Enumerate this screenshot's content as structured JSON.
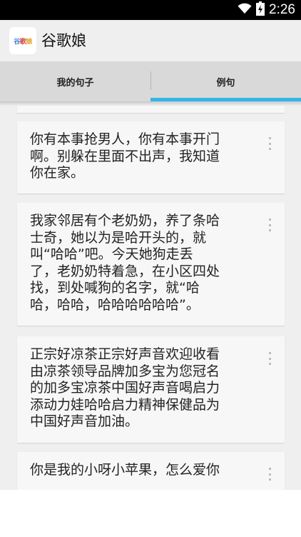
{
  "status_bar": {
    "time": "2:26",
    "icons": [
      "wifi-icon",
      "battery-icon"
    ]
  },
  "app_bar": {
    "icon_text": [
      "谷",
      "歌",
      "娘"
    ],
    "title": "谷歌娘"
  },
  "tabs": [
    {
      "label": "我的句子",
      "selected": false
    },
    {
      "label": "例句",
      "selected": true
    }
  ],
  "accent_color": "#33b5e5",
  "cards": [
    {
      "text": "你有本事抢男人，你有本事开门\n啊。别躲在里面不出声，我知道\n你在家。",
      "menu_icon": "overflow-menu-icon"
    },
    {
      "text": "我家邻居有个老奶奶，养了条哈\n士奇，她以为是哈开头的，就\n叫“哈哈”吧。今天她狗走丢\n了，老奶奶特着急，在小区四处\n找，到处喊狗的名字，就“哈\n哈，哈哈，哈哈哈哈哈哈”。",
      "menu_icon": "overflow-menu-icon"
    },
    {
      "text": "正宗好凉茶正宗好声音欢迎收看\n由凉茶领导品牌加多宝为您冠名\n的加多宝凉茶中国好声音喝启力\n添动力娃哈哈启力精神保健品为\n中国好声音加油。",
      "menu_icon": "overflow-menu-icon"
    },
    {
      "text": "你是我的小呀小苹果，怎么爱你",
      "menu_icon": "overflow-menu-icon"
    }
  ]
}
